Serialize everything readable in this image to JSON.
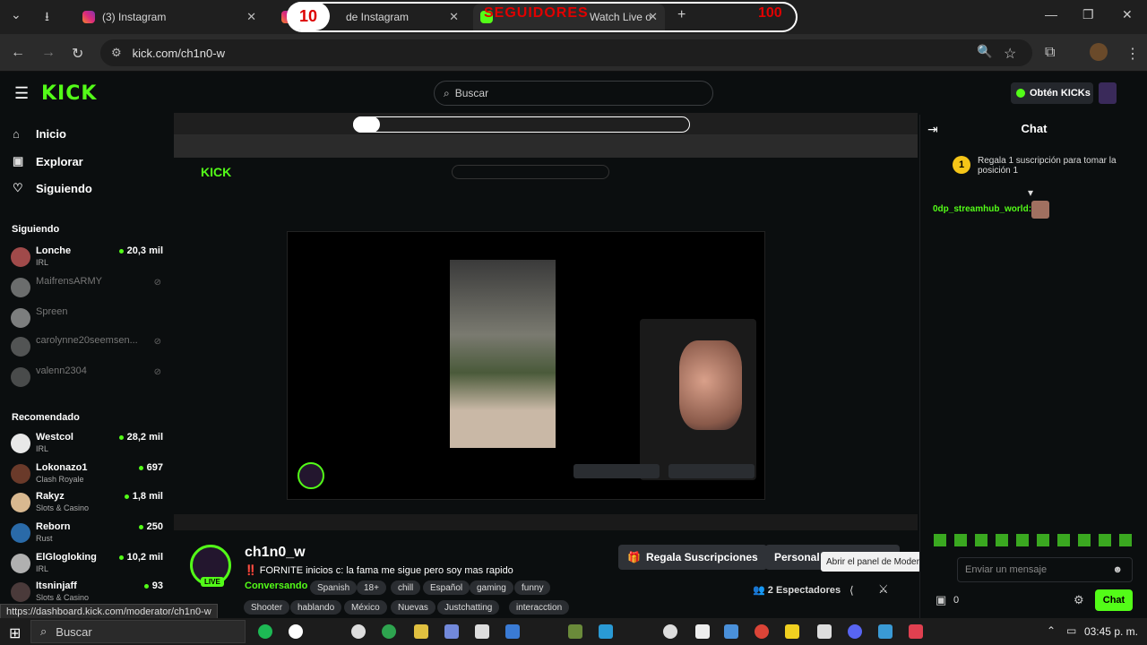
{
  "browser": {
    "tabs": [
      {
        "label": "(3) Instagram"
      },
      {
        "label": "de Instagram"
      },
      {
        "label": "Watch Live o"
      }
    ],
    "url": "kick.com/ch1n0-w",
    "overlay": {
      "start": "10",
      "label": "SEGUIDORES",
      "end": "100"
    }
  },
  "header": {
    "logo": "KICK",
    "search_placeholder": "Buscar",
    "obten_label": "Obtén KICKs"
  },
  "sidebar": {
    "nav": [
      {
        "label": "Inicio",
        "icon": "home-icon"
      },
      {
        "label": "Explorar",
        "icon": "compass-icon"
      },
      {
        "label": "Siguiendo",
        "icon": "heart-icon"
      }
    ],
    "following_title": "Siguiendo",
    "following": [
      {
        "name": "Lonche",
        "category": "IRL",
        "viewers": "20,3 mil",
        "online": true
      },
      {
        "name": "MaifrensARMY",
        "online": false
      },
      {
        "name": "Spreen",
        "online": false
      },
      {
        "name": "carolynne20seemsen...",
        "online": false
      },
      {
        "name": "valenn2304",
        "online": false
      }
    ],
    "recommended_title": "Recomendado",
    "recommended": [
      {
        "name": "Westcol",
        "category": "IRL",
        "viewers": "28,2 mil"
      },
      {
        "name": "Lokonazo1",
        "category": "Clash Royale",
        "viewers": "697"
      },
      {
        "name": "Rakyz",
        "category": "Slots & Casino",
        "viewers": "1,8 mil"
      },
      {
        "name": "Reborn",
        "category": "Rust",
        "viewers": "250"
      },
      {
        "name": "ElGlogloking",
        "category": "IRL",
        "viewers": "10,2 mil"
      },
      {
        "name": "Itsninjaff",
        "category": "Slots & Casino",
        "viewers": "93"
      }
    ]
  },
  "stream": {
    "name": "ch1n0_w",
    "live": "LIVE",
    "title": "‼️ FORNITE inicios  c: la fama me sigue pero soy mas rapido",
    "category": "Conversando",
    "tags": [
      "Spanish",
      "18+",
      "chill",
      "Español",
      "gaming",
      "funny"
    ],
    "tags2": [
      "Shooter",
      "hablando",
      "México",
      "Nuevas",
      "Justchatting",
      "interacction"
    ],
    "gift_subs": "Regala Suscripciones",
    "customize": "Personal",
    "viewers": "2 Espectadores",
    "tooltip": "Abrir el panel de Moderación",
    "status_url": "https://dashboard.kick.com/moderator/ch1n0-w"
  },
  "chat": {
    "title": "Chat",
    "gift_badge": "1",
    "gift_text": "Regala 1 suscripción para tomar la posición 1",
    "user": "0dp_streamhub_world:",
    "input_placeholder": "Enviar un mensaje",
    "count": "0",
    "send_label": "Chat"
  },
  "taskbar": {
    "search": "Buscar",
    "clock": "03:45 p. m."
  }
}
